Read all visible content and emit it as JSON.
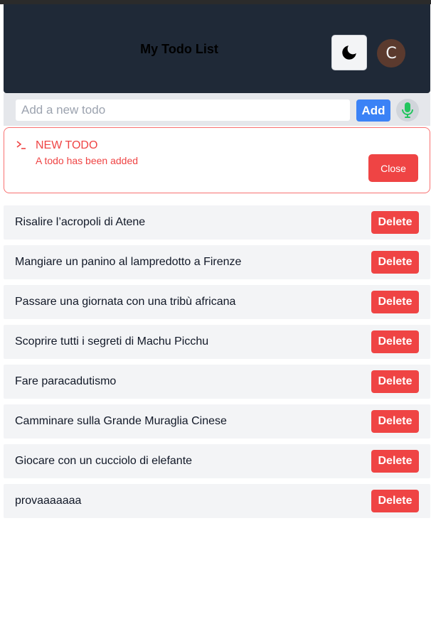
{
  "header": {
    "title": "My Todo List",
    "theme_toggle_icon": "moon-icon",
    "avatar_initial": "C"
  },
  "new_todo": {
    "placeholder": "Add a new todo",
    "value": "",
    "add_label": "Add",
    "mic_icon": "microphone-icon"
  },
  "alert": {
    "icon": "terminal-icon",
    "title": "NEW TODO",
    "message": "A todo has been added",
    "close_label": "Close"
  },
  "todos": [
    {
      "text": "Risalire l’acropoli di Atene",
      "delete_label": "Delete"
    },
    {
      "text": "Mangiare un panino al lampredotto a Firenze",
      "delete_label": "Delete"
    },
    {
      "text": "Passare una giornata con una tribù africana",
      "delete_label": "Delete"
    },
    {
      "text": "Scoprire tutti i segreti di Machu Picchu",
      "delete_label": "Delete"
    },
    {
      "text": "Fare paracadutismo",
      "delete_label": "Delete"
    },
    {
      "text": "Camminare sulla Grande Muraglia Cinese",
      "delete_label": "Delete"
    },
    {
      "text": "Giocare con un cucciolo di elefante",
      "delete_label": "Delete"
    },
    {
      "text": "provaaaaaaa",
      "delete_label": "Delete"
    }
  ],
  "colors": {
    "header_bg": "#1f2937",
    "add_button": "#3b82f6",
    "danger": "#ef4444",
    "mic": "#22c55e",
    "avatar_bg": "#5b3a2e"
  }
}
